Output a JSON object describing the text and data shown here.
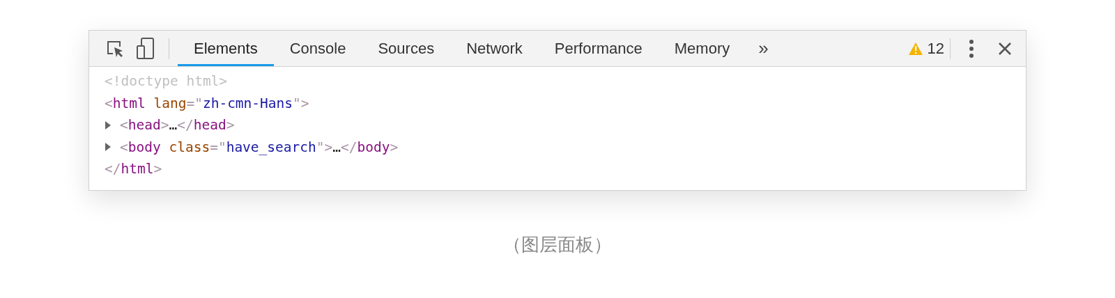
{
  "toolbar": {
    "tabs": [
      {
        "label": "Elements",
        "selected": true
      },
      {
        "label": "Console",
        "selected": false
      },
      {
        "label": "Sources",
        "selected": false
      },
      {
        "label": "Network",
        "selected": false
      },
      {
        "label": "Performance",
        "selected": false
      },
      {
        "label": "Memory",
        "selected": false
      }
    ],
    "overflow": "»",
    "warnings": "12"
  },
  "dom_tree": [
    {
      "expandable": false,
      "tokens": [
        {
          "kind": "doctype",
          "text": "<!doctype html>"
        }
      ]
    },
    {
      "expandable": false,
      "tokens": [
        {
          "kind": "punct",
          "text": "<"
        },
        {
          "kind": "tag",
          "text": "html"
        },
        {
          "kind": "attr",
          "text": "lang"
        },
        {
          "kind": "punct",
          "text": "=\""
        },
        {
          "kind": "value",
          "text": "zh-cmn-Hans"
        },
        {
          "kind": "punct",
          "text": "\">"
        }
      ]
    },
    {
      "expandable": true,
      "tokens": [
        {
          "kind": "punct",
          "text": "<"
        },
        {
          "kind": "tag",
          "text": "head"
        },
        {
          "kind": "punct",
          "text": ">"
        },
        {
          "kind": "text",
          "text": "…"
        },
        {
          "kind": "punct",
          "text": "</"
        },
        {
          "kind": "tag",
          "text": "head"
        },
        {
          "kind": "punct",
          "text": ">"
        }
      ]
    },
    {
      "expandable": true,
      "tokens": [
        {
          "kind": "punct",
          "text": "<"
        },
        {
          "kind": "tag",
          "text": "body"
        },
        {
          "kind": "attr",
          "text": "class"
        },
        {
          "kind": "punct",
          "text": "=\""
        },
        {
          "kind": "value",
          "text": "have_search"
        },
        {
          "kind": "punct",
          "text": "\">"
        },
        {
          "kind": "text",
          "text": "…"
        },
        {
          "kind": "punct",
          "text": "</"
        },
        {
          "kind": "tag",
          "text": "body"
        },
        {
          "kind": "punct",
          "text": ">"
        }
      ]
    },
    {
      "expandable": false,
      "tokens": [
        {
          "kind": "punct",
          "text": "</"
        },
        {
          "kind": "tag",
          "text": "html"
        },
        {
          "kind": "punct",
          "text": ">"
        }
      ]
    }
  ],
  "caption": "（图层面板）"
}
